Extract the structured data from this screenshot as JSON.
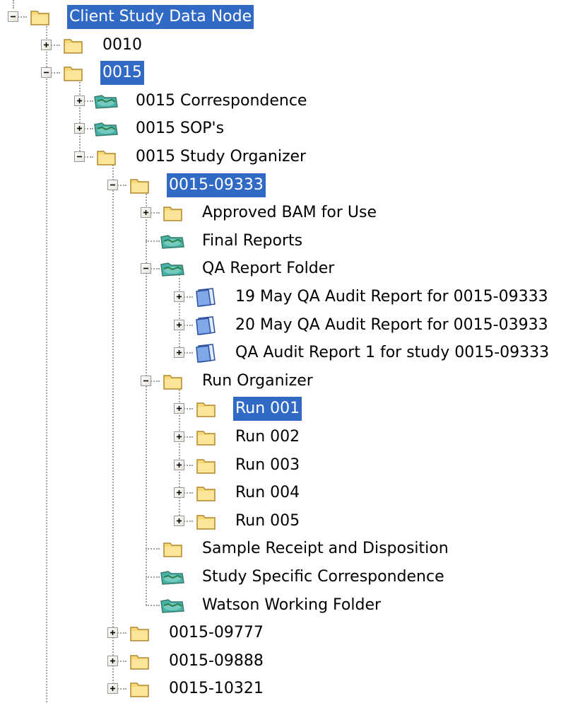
{
  "tree": {
    "nodes": [
      {
        "id": "client-study-data-node",
        "label": "Client Study Data Node",
        "level": 0,
        "icon": "folder-icon",
        "expander": "minus",
        "selected": true,
        "children": [
          "0010",
          "0015"
        ]
      },
      {
        "id": "0010",
        "label": "0010",
        "level": 1,
        "icon": "folder-icon",
        "expander": "plus",
        "selected": false
      },
      {
        "id": "0015",
        "label": "0015",
        "level": 1,
        "icon": "folder-icon",
        "expander": "minus",
        "selected": true
      },
      {
        "id": "0015-correspondence",
        "label": "0015 Correspondence",
        "level": 2,
        "icon": "network-folder-icon",
        "expander": "plus",
        "selected": false
      },
      {
        "id": "0015-sops",
        "label": "0015 SOP's",
        "level": 2,
        "icon": "network-folder-icon",
        "expander": "plus",
        "selected": false
      },
      {
        "id": "0015-study-organizer",
        "label": "0015 Study Organizer",
        "level": 2,
        "icon": "folder-icon",
        "expander": "minus",
        "selected": false
      },
      {
        "id": "0015-09333",
        "label": "0015-09333",
        "level": 3,
        "icon": "folder-icon",
        "expander": "minus",
        "selected": true
      },
      {
        "id": "approved-bam",
        "label": "Approved BAM for Use",
        "level": 4,
        "icon": "folder-icon",
        "expander": "plus",
        "selected": false
      },
      {
        "id": "final-reports",
        "label": "Final Reports",
        "level": 4,
        "icon": "network-folder-icon",
        "expander": "none",
        "selected": false
      },
      {
        "id": "qa-report-folder",
        "label": "QA Report Folder",
        "level": 4,
        "icon": "network-folder-icon",
        "expander": "minus",
        "selected": false
      },
      {
        "id": "qa-19-may",
        "label": "19 May QA Audit Report for 0015-09333",
        "level": 5,
        "icon": "document-icon",
        "expander": "plus",
        "selected": false
      },
      {
        "id": "qa-20-may",
        "label": "20 May QA Audit Report for 0015-03933",
        "level": 5,
        "icon": "document-icon",
        "expander": "plus",
        "selected": false
      },
      {
        "id": "qa-audit-1",
        "label": "QA Audit Report 1 for study 0015-09333",
        "level": 5,
        "icon": "document-icon",
        "expander": "plus",
        "selected": false
      },
      {
        "id": "run-organizer",
        "label": "Run Organizer",
        "level": 4,
        "icon": "folder-icon",
        "expander": "minus",
        "selected": false
      },
      {
        "id": "run-001",
        "label": "Run 001",
        "level": 5,
        "icon": "folder-icon",
        "expander": "plus",
        "selected": true
      },
      {
        "id": "run-002",
        "label": "Run 002",
        "level": 5,
        "icon": "folder-icon",
        "expander": "plus",
        "selected": false
      },
      {
        "id": "run-003",
        "label": "Run 003",
        "level": 5,
        "icon": "folder-icon",
        "expander": "plus",
        "selected": false
      },
      {
        "id": "run-004",
        "label": "Run 004",
        "level": 5,
        "icon": "folder-icon",
        "expander": "plus",
        "selected": false
      },
      {
        "id": "run-005",
        "label": "Run 005",
        "level": 5,
        "icon": "folder-icon",
        "expander": "plus",
        "selected": false
      },
      {
        "id": "sample-receipt",
        "label": "Sample Receipt and Disposition",
        "level": 4,
        "icon": "folder-icon",
        "expander": "none",
        "selected": false
      },
      {
        "id": "study-specific-correspondence",
        "label": "Study Specific Correspondence",
        "level": 4,
        "icon": "network-folder-icon",
        "expander": "none",
        "selected": false
      },
      {
        "id": "watson-working-folder",
        "label": "Watson Working Folder",
        "level": 4,
        "icon": "network-folder-icon",
        "expander": "none",
        "selected": false
      },
      {
        "id": "0015-09777",
        "label": "0015-09777",
        "level": 3,
        "icon": "folder-icon",
        "expander": "plus",
        "selected": false
      },
      {
        "id": "0015-09888",
        "label": "0015-09888",
        "level": 3,
        "icon": "folder-icon",
        "expander": "plus",
        "selected": false
      },
      {
        "id": "0015-10321",
        "label": "0015-10321",
        "level": 3,
        "icon": "folder-icon",
        "expander": "plus",
        "selected": false
      }
    ]
  },
  "colors": {
    "selection_bg": "#316ac5",
    "selection_text": "#ffffff",
    "folder_fill": "#f7d97a",
    "network_folder_fill": "#47b3a8",
    "document_fill": "#7ea8e8",
    "tree_line": "#a0a0a0"
  }
}
